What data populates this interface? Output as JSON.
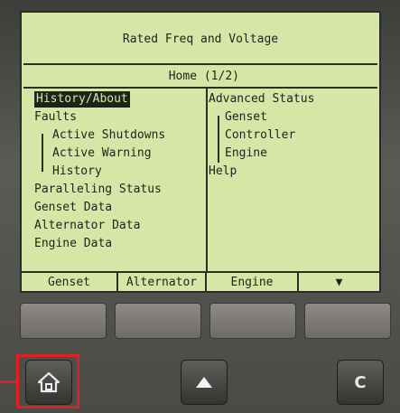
{
  "lcd": {
    "title": "Rated Freq and Voltage",
    "page": "Home (1/2)",
    "left_items": [
      {
        "label": "History/About",
        "selected": true,
        "indent": 0
      },
      {
        "label": "Faults",
        "selected": false,
        "indent": 0
      },
      {
        "label": "Active Shutdowns",
        "selected": false,
        "indent": 1
      },
      {
        "label": "Active Warning",
        "selected": false,
        "indent": 1
      },
      {
        "label": "History",
        "selected": false,
        "indent": 1
      },
      {
        "label": "Paralleling Status",
        "selected": false,
        "indent": 0
      },
      {
        "label": "Genset Data",
        "selected": false,
        "indent": 0
      },
      {
        "label": "Alternator Data",
        "selected": false,
        "indent": 0
      },
      {
        "label": "Engine Data",
        "selected": false,
        "indent": 0
      }
    ],
    "right_items": [
      {
        "label": "Advanced Status",
        "indent": 0
      },
      {
        "label": "Genset",
        "indent": 1
      },
      {
        "label": "Controller",
        "indent": 1
      },
      {
        "label": "Engine",
        "indent": 1
      },
      {
        "label": "Help",
        "indent": 0
      }
    ],
    "soft_tabs": [
      "Genset",
      "Alternator",
      "Engine",
      "▼"
    ]
  },
  "buttons": {
    "home_icon": "home-icon",
    "up_icon": "triangle-up-icon",
    "c_label": "C"
  },
  "colors": {
    "lcd_bg": "#d6e6a6",
    "lcd_text": "#1e2418",
    "highlight": "#e02020"
  }
}
